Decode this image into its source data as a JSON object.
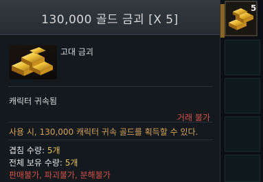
{
  "tooltip": {
    "title": "130,000 골드 금괴 [X 5]",
    "item_name": "고대 금괴",
    "binding": "캐릭터 귀속됨",
    "trade": "거래 불가",
    "description": "사용 시, 130,000 캐릭터 귀속 골드를 획득할 수 있다.",
    "stack_label": "겹침 수량: ",
    "stack_value": "5개",
    "total_label": "전체 보유 수량: ",
    "total_value": "5개",
    "restrictions": [
      "판매불가",
      "파괴불가",
      "분해불가"
    ],
    "restriction_sep": ", "
  },
  "inventory": {
    "left_slot_count": "5",
    "right_slot_count": "5",
    "right_slot_icon": "gold-bars-icon"
  },
  "colors": {
    "description": "#d7a35a",
    "warning": "#d2524b",
    "value": "#e2c35a"
  }
}
